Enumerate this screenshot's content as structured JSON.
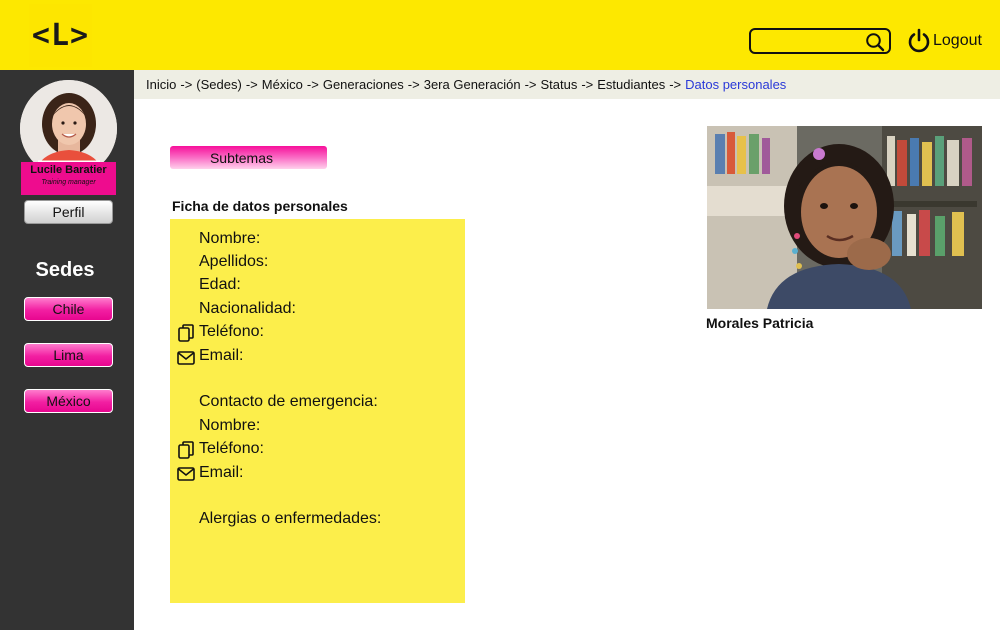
{
  "header": {
    "logo_text": "<L>",
    "search": {
      "value": "",
      "placeholder": ""
    },
    "logout_label": "Logout"
  },
  "sidebar": {
    "profile": {
      "name": "Lucile Baratier",
      "role": "Training manager"
    },
    "perfil_label": "Perfil",
    "sedes_title": "Sedes",
    "sedes": [
      "Chile",
      "Lima",
      "México"
    ]
  },
  "breadcrumb": {
    "items": [
      "Inicio",
      "(Sedes)",
      "México",
      "Generaciones",
      "3era Generación",
      "Status",
      "Estudiantes"
    ],
    "separator": "->",
    "current": "Datos personales"
  },
  "main": {
    "subtemas_label": "Subtemas",
    "card_title": "Ficha de datos personales",
    "fields": {
      "nombre": "Nombre:",
      "apellidos": "Apellidos:",
      "edad": "Edad:",
      "nacionalidad": "Nacionalidad:",
      "telefono": "Teléfono:",
      "email": "Email:",
      "contacto_emergencia": "Contacto de emergencia:",
      "emergencia_nombre": "Nombre:",
      "emergencia_telefono": "Teléfono:",
      "emergencia_email": "Email:",
      "alergias": "Alergias o enfermedades:"
    },
    "student_name": "Morales Patricia"
  },
  "colors": {
    "header_yellow": "#fde800",
    "sidebar_dark": "#333333",
    "accent_pink": "#f21fa2",
    "card_yellow": "#fcee4b",
    "breadcrumb_current": "#2a39d8"
  }
}
